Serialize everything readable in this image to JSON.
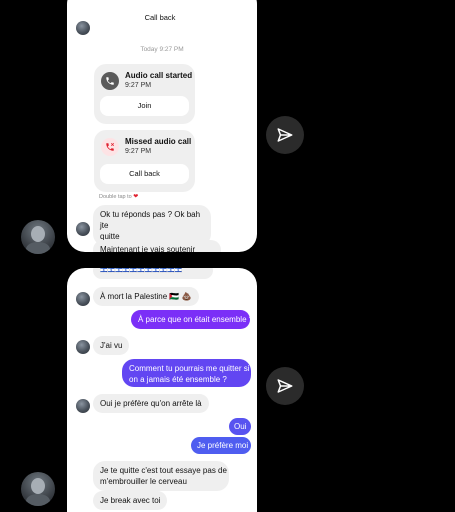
{
  "top": {
    "call_back_top": "Call back",
    "timestamp": "Today 9:27 PM",
    "call_started": {
      "title": "Audio call started",
      "time": "9:27 PM",
      "button": "Join"
    },
    "call_missed": {
      "title": "Missed audio call",
      "time": "9:27 PM",
      "button": "Call back"
    },
    "double_tap": "Double tap to",
    "msg1_line1": "Ok tu réponds pas ? Ok bah jte",
    "msg1_line2": "quitte",
    "msg2": "Maintenant je vais soutenir Israël"
  },
  "bottom": {
    "flags": "🇮🇱🇮🇱🇮🇱🇮🇱🇮🇱🇮🇱🇮🇱🇮🇱🇮🇱🇮🇱🇮🇱",
    "msg_palestine": "À mort la Palestine 🇵🇸 💩",
    "out1": "À parce que on était ensemble ?",
    "in_jai_vu": "J'ai vu",
    "out2_line1": "Comment tu pourrais me quitter si",
    "out2_line2": "on a jamais été ensemble ?",
    "in_prefere": "Oui je préfère qu'on arrête là",
    "out_oui": "Oui",
    "out_prefere": "Je préfère moi",
    "in_quitte_line1": "Je te quitte c'est tout essaye pas de",
    "in_quitte_line2": "m'embrouiller le cerveau",
    "in_break": "Je break avec toi"
  },
  "colors": {
    "purple": "#7b2ff7",
    "blue": "#4f5df0",
    "missed_red": "#e0212f"
  },
  "icons": {
    "send": "send-icon",
    "phone": "phone-icon",
    "missed": "missed-call-icon",
    "heart": "heart-icon"
  }
}
